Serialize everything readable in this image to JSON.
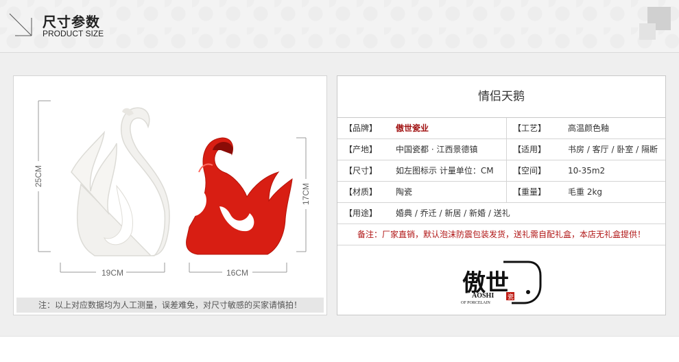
{
  "header": {
    "title_cn": "尺寸参数",
    "title_en": "PRODUCT SIZE"
  },
  "photo": {
    "dimensions": {
      "height_white": "25CM",
      "width_white": "19CM",
      "height_red": "17CM",
      "width_red": "16CM"
    },
    "note": "注：以上对应数据均为人工测量，误差难免，对尺寸敏感的买家请慎拍！",
    "colors": {
      "white_swan": "#f2f1ee",
      "red_swan": "#d81e13"
    }
  },
  "spec": {
    "title": "情侣天鹅",
    "rows": [
      {
        "l_label": "【品牌】",
        "l_value": "傲世瓷业",
        "r_label": "【工艺】",
        "r_value": "高温颜色釉"
      },
      {
        "l_label": "【产地】",
        "l_value": "中国瓷都 · 江西景德镇",
        "r_label": "【适用】",
        "r_value": "书房 / 客厅 / 卧室 / 隔断"
      },
      {
        "l_label": "【尺寸】",
        "l_value": "如左图标示 计量单位：CM",
        "r_label": "【空间】",
        "r_value": "10-35m2"
      },
      {
        "l_label": "【材质】",
        "l_value": "陶瓷",
        "r_label": "【重量】",
        "r_value": "毛重 2kg"
      }
    ],
    "use_label": "【用途】",
    "use_value": "婚典 / 乔迁 / 新居 / 新婚 / 送礼",
    "remark": "备注：厂家直销，默认泡沫防震包装发货，送礼需自配礼盒，本店无礼盒提供！",
    "logo": {
      "name_cn": "傲世",
      "name_en": "AOSHI",
      "tagline": "OF PORCELAIN",
      "seal_char": "瓷"
    },
    "brand_color": "#a01010"
  }
}
